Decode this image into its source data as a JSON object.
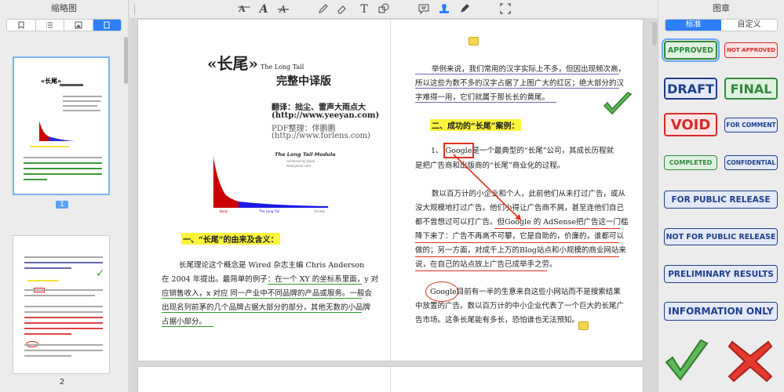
{
  "left_panel": {
    "title": "缩略图",
    "tabs": [
      "bookmark-icon",
      "list-icon",
      "image-icon",
      "page-icon"
    ],
    "pages": [
      {
        "number": "1",
        "selected": true
      },
      {
        "number": "2",
        "selected": false
      }
    ]
  },
  "toolbar": {
    "tools": [
      "text-box-icon",
      "text-icon",
      "strikethrough-icon",
      "pencil-icon",
      "eraser-icon",
      "typewriter-icon",
      "shape-icon",
      "comment-icon",
      "stamp-icon",
      "pen-icon",
      "crop-icon"
    ]
  },
  "document": {
    "page_left": {
      "title": "«长尾»",
      "title_en": "The Long Tail",
      "subtitle": "完整中译版",
      "translators": "翻译：拙尘、雷声大雨点大",
      "url1": "(http://www.yeeyan.com)",
      "pdf_line": "PDF整理：伴鹏鹏",
      "url2": "(http://www.forlens.com)",
      "chart_title": "The Long Tail Module",
      "chart_sub1": "rendered by Jason",
      "chart_sub2": "www.jason.com",
      "chart_label_body": "Body",
      "chart_label_tail": "The Long Tail",
      "chart_label_x": "Variety",
      "section1": "一、“长尾”的由来及含义：",
      "para1": [
        "长尾理论这个概念是 Wired 杂志主编 Chris Anderson",
        "在 2004 年提出。最简单的例子：在一个 XY 的坐标系里面，y 对",
        "应销售收入，x 对应  同一产业中不同品牌的产品或服务。一般会",
        "出现名列前茅的几个品牌占据大部分的部分，其他无数的小品牌",
        "占据小部分。"
      ]
    },
    "page_right": {
      "para0": [
        "举例来说，我们常用的汉字实际上不多，但因出现频次高，",
        "所以这些为数不多的汉字占据了上图广大的红区；绝大部分的汉",
        "字难得一用，它们就属于那长长的黄尾。"
      ],
      "section2": "二、成功的“长尾”案例：",
      "para1": [
        "1、 Google是一个最典型的“长尾”公司，其成长历程就",
        "是把广告商和出版商的“长尾”商业化的过程。"
      ],
      "para2": [
        "数以百万计的小企业和个人，此前他们从未打过广告，或从",
        "没大规模地打过广告。他们小得让广告商不屑，甚至连他们自己",
        "都不曾想过可以打广告。但Google 的 AdSense把广告这一门槛",
        "降下来了：广告不再高不可攀，它是自助的，价廉的，谁都可以",
        "做的；另一方面，对成千上万的Blog站点和小规模的商业网站来",
        "说，在自己的站点放上广告已成举手之劳。"
      ],
      "para3": [
        "Google目前有一半的生意来自这些小网站而不是搜索结果",
        "中放置的广告。数以百万计的中小企业代表了一个巨大的长尾广",
        "告市场。这条长尾能有多长，恐怕谁也无法预知。"
      ]
    }
  },
  "right_panel": {
    "title": "图章",
    "tabs": [
      "标准",
      "自定义"
    ],
    "stamps": [
      {
        "label": "APPROVED",
        "color": "#2f8a3c"
      },
      {
        "label": "NOT APPROVED",
        "color": "#d62a2a"
      },
      {
        "label": "DRAFT",
        "color": "#1f3f8a"
      },
      {
        "label": "FINAL",
        "color": "#2f8a3c"
      },
      {
        "label": "VOID",
        "color": "#d62a2a"
      },
      {
        "label": "FOR COMMENT",
        "color": "#1f3f8a"
      },
      {
        "label": "COMPLETED",
        "color": "#2f8a3c"
      },
      {
        "label": "CONFIDENTIAL",
        "color": "#1f3f8a"
      },
      {
        "label": "FOR PUBLIC RELEASE",
        "color": "#1f3f8a"
      },
      {
        "label": "NOT FOR PUBLIC RELEASE",
        "color": "#1f3f8a"
      },
      {
        "label": "PRELIMINARY RESULTS",
        "color": "#1f3f8a"
      },
      {
        "label": "INFORMATION ONLY",
        "color": "#1f3f8a"
      }
    ],
    "check_icon": "checkmark-stamp-icon",
    "cross_icon": "cross-stamp-icon"
  },
  "colors": {
    "accent": "#2d7ff9",
    "highlight": "#fbf33a",
    "markup_red": "#e0321e"
  }
}
